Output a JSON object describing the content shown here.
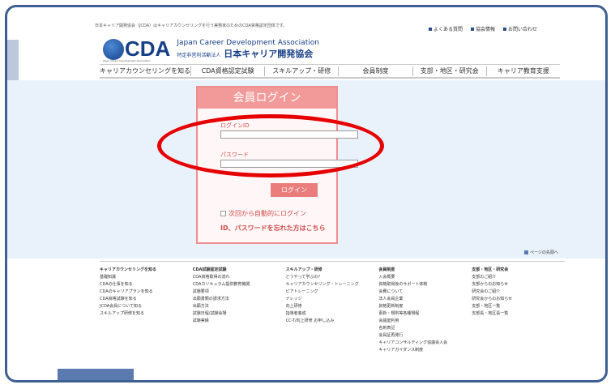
{
  "top_note": "日本キャリア開発協会（JCDA）はキャリアカウンセリングを行う実務家のためのCDA資格認定団体です。",
  "top_links": [
    "よくある質問",
    "協会情報",
    "お問い合わせ"
  ],
  "logo": {
    "cda": "CDA",
    "eng": "Japan Career Development Association",
    "jpn_prefix": "特定非営利活動法人",
    "jpn": "日本キャリア開発協会",
    "sub": "Japan Career Development Association"
  },
  "nav": [
    "キャリアカウンセリングを知る",
    "CDA資格認定試験",
    "スキルアップ・研修",
    "会員制度",
    "支部・地区・研究会",
    "キャリア教育支援"
  ],
  "login": {
    "title": "会員ログイン",
    "id_label": "ログインID",
    "id_value": "",
    "password_label": "パスワード",
    "password_value": "",
    "button": "ログイン",
    "auto_login": "次回から自動的にログイン",
    "forgot": "ID、パスワードを忘れた方はこちら"
  },
  "page_top": "ページの先頭へ",
  "footer": [
    {
      "title": "キャリアカウンセリングを知る",
      "items": [
        "基礎知識",
        "CDAの仕事を知る",
        "CDAのキャリアプランを知る",
        "CDA資格試験を知る",
        "JCDA会員について知る",
        "スキルアップ研修を知る"
      ]
    },
    {
      "title": "CDA試験認定試験",
      "items": [
        "CDA資格取得の流れ",
        "CDAカリキュラム提供教育機関",
        "試験要項",
        "出願書類の請求方法",
        "出願方法",
        "試験日程/試験会場",
        "試験実績"
      ]
    },
    {
      "title": "スキルアップ・研修",
      "items": [
        "どうやって学ぶの?",
        "キャリアカウンセリング・トレーニング",
        "ピアトレーニング",
        "ナレッジ",
        "向上研修",
        "指導者養成",
        "CC-T/向上研修 お申し込み"
      ]
    },
    {
      "title": "会員制度",
      "items": [
        "入会概要",
        "資格取得後のサポート体制",
        "会費について",
        "法人会員企業",
        "資格更新制度",
        "更新・規則等各種規程",
        "会議室利用",
        "名刺表記",
        "会員証再発行",
        "キャリアコンサルティング協議会入会",
        "キャリアガイダンス制度"
      ]
    },
    {
      "title": "支部・地区・研究会",
      "items": [
        "支部のご紹介",
        "支部からのお知らせ",
        "研究会のご紹介",
        "研究会からのお知らせ",
        "支部・地区一覧",
        "支部長・地区長一覧"
      ]
    }
  ]
}
